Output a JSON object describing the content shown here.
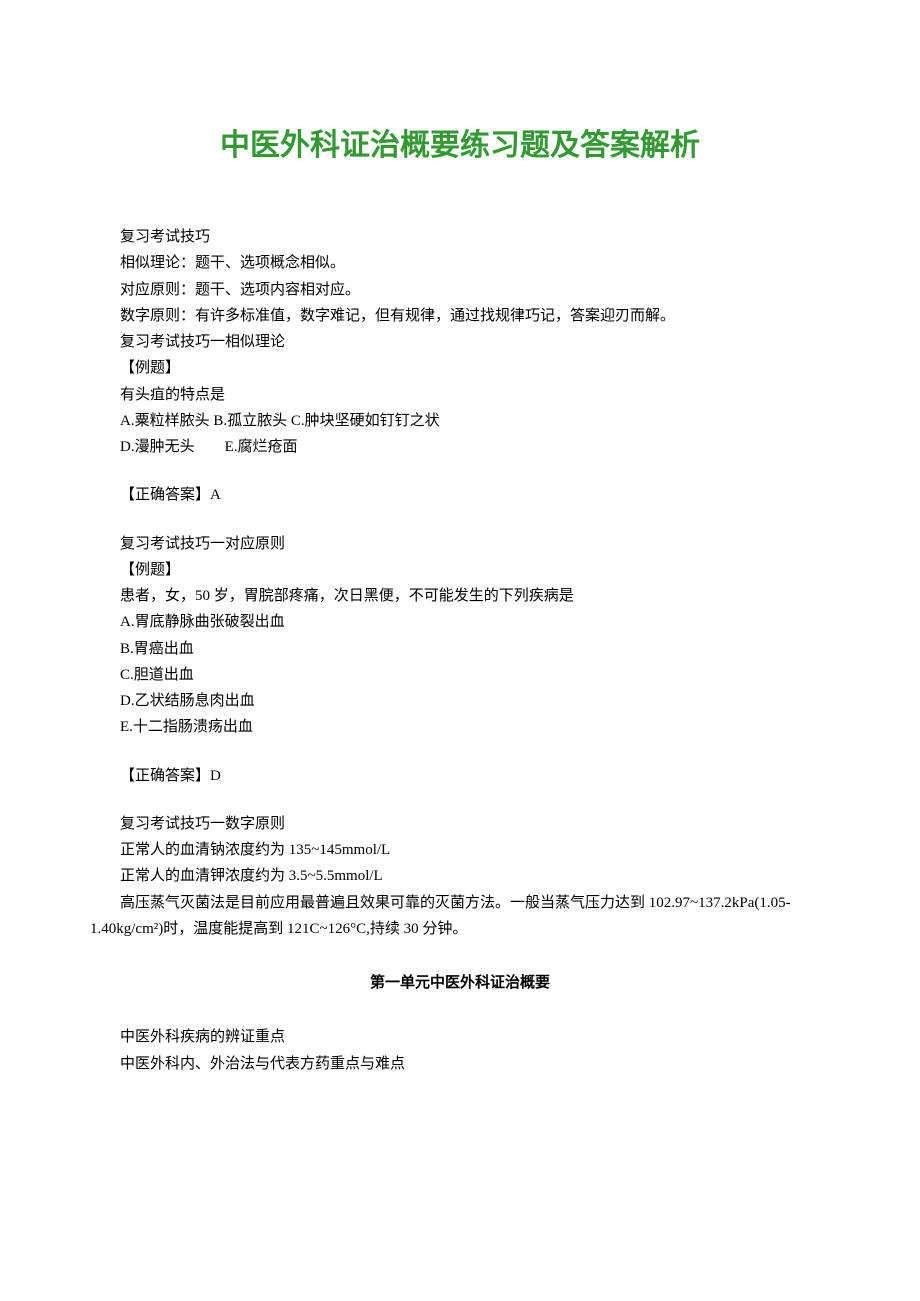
{
  "title": "中医外科证治概要练习题及答案解析",
  "p1": "复习考试技巧",
  "p2": "相似理论：题干、选项概念相似。",
  "p3": "对应原则：题干、选项内容相对应。",
  "p4": "数字原则：有许多标准值，数字难记，但有规律，通过找规律巧记，答案迎刃而解。",
  "p5": "复习考试技巧一相似理论",
  "p6": "【例题】",
  "p7": "有头疽的特点是",
  "p8": "A.粟粒样脓头 B.孤立脓头 C.肿块坚硬如钉钉之状",
  "p9": "D.漫肿无头　　E.腐烂疮面",
  "p10": "【正确答案】A",
  "p11": "复习考试技巧一对应原则",
  "p12": "【例题】",
  "p13": "患者，女，50 岁，胃脘部疼痛，次日黑便，不可能发生的下列疾病是",
  "p14": "A.胃底静脉曲张破裂出血",
  "p15": "B.胃癌出血",
  "p16": "C.胆道出血",
  "p17": "D.乙状结肠息肉出血",
  "p18": "E.十二指肠溃疡出血",
  "p19": "【正确答案】D",
  "p20": "复习考试技巧一数字原则",
  "p21": "正常人的血清钠浓度约为 135~145mmol/L",
  "p22": "正常人的血清钾浓度约为 3.5~5.5mmol/L",
  "p23": "高压蒸气灭菌法是目前应用最普遍且效果可靠的灭菌方法。一般当蒸气压力达到 102.97~137.2kPa(1.05-1.40kg/cm²)时，温度能提高到 121C~126°C,持续 30 分钟。",
  "sectionHeading": "第一单元中医外科证治概要",
  "p24": "中医外科疾病的辨证重点",
  "p25": "中医外科内、外治法与代表方药重点与难点"
}
